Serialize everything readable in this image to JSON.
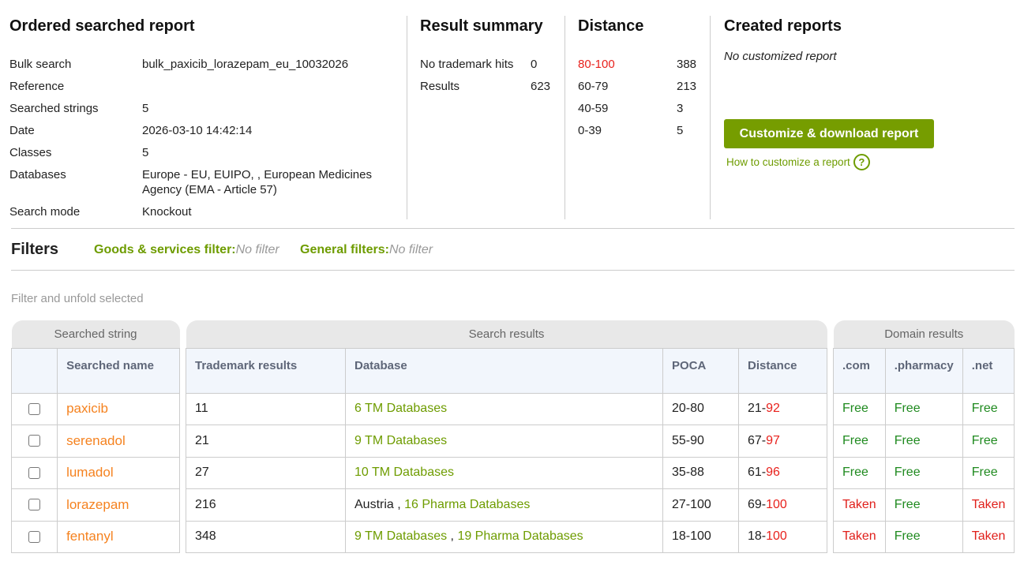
{
  "report": {
    "title": "Ordered searched report",
    "rows": [
      {
        "label": "Bulk search",
        "value": "bulk_paxicib_lorazepam_eu_10032026"
      },
      {
        "label": "Reference",
        "value": ""
      },
      {
        "label": "Searched strings",
        "value": "5"
      },
      {
        "label": "Date",
        "value": "2026-03-10 14:42:14"
      },
      {
        "label": "Classes",
        "value": "5"
      },
      {
        "label": "Databases",
        "value": "Europe - EU, EUIPO, , European Medicines Agency (EMA - Article 57)"
      },
      {
        "label": "Search mode",
        "value": "Knockout"
      }
    ]
  },
  "summary": {
    "title": "Result summary",
    "rows": [
      {
        "label": "No trademark hits",
        "value": "0"
      },
      {
        "label": "Results",
        "value": "623"
      }
    ]
  },
  "distance": {
    "title": "Distance",
    "rows": [
      {
        "label": "80-100",
        "value": "388"
      },
      {
        "label": "60-79",
        "value": "213"
      },
      {
        "label": "40-59",
        "value": "3"
      },
      {
        "label": "0-39",
        "value": "5"
      }
    ]
  },
  "created": {
    "title": "Created reports",
    "empty": "No customized report",
    "button": "Customize & download report",
    "help": "How to customize a report",
    "help_icon": "?"
  },
  "filters": {
    "title": "Filters",
    "goods_label": "Goods & services filter:",
    "goods_value": "No filter",
    "general_label": "General filters:",
    "general_value": "No filter",
    "unfold": "Filter and unfold selected"
  },
  "table": {
    "groups": {
      "searched": "Searched string",
      "search": "Search results",
      "domain": "Domain results"
    },
    "headers": {
      "name": "Searched name",
      "tm": "Trademark results",
      "db": "Database",
      "poca": "POCA",
      "distance": "Distance",
      "com": ".com",
      "pharmacy": ".pharmacy",
      "net": ".net"
    },
    "rows": [
      {
        "name": "paxicib",
        "tm": "11",
        "db": [
          {
            "text": "6 TM Databases",
            "link": true
          }
        ],
        "poca": "20-80",
        "dist_low": "21-",
        "dist_high": "92",
        "com": "Free",
        "pharmacy": "Free",
        "net": "Free"
      },
      {
        "name": "serenadol",
        "tm": "21",
        "db": [
          {
            "text": "9 TM Databases",
            "link": true
          }
        ],
        "poca": "55-90",
        "dist_low": "67-",
        "dist_high": "97",
        "com": "Free",
        "pharmacy": "Free",
        "net": "Free"
      },
      {
        "name": "lumadol",
        "tm": "27",
        "db": [
          {
            "text": "10 TM Databases",
            "link": true
          }
        ],
        "poca": "35-88",
        "dist_low": "61-",
        "dist_high": "96",
        "com": "Free",
        "pharmacy": "Free",
        "net": "Free"
      },
      {
        "name": "lorazepam",
        "tm": "216",
        "db": [
          {
            "text": "Austria , ",
            "link": false
          },
          {
            "text": "16 Pharma Databases",
            "link": true
          }
        ],
        "poca": "27-100",
        "dist_low": "69-",
        "dist_high": "100",
        "com": "Taken",
        "pharmacy": "Free",
        "net": "Taken"
      },
      {
        "name": "fentanyl",
        "tm": "348",
        "db": [
          {
            "text": "9 TM Databases",
            "link": true
          },
          {
            "text": " , ",
            "link": false
          },
          {
            "text": "19 Pharma Databases",
            "link": true
          }
        ],
        "poca": "18-100",
        "dist_low": "18-",
        "dist_high": "100",
        "com": "Taken",
        "pharmacy": "Free",
        "net": "Taken"
      }
    ]
  }
}
